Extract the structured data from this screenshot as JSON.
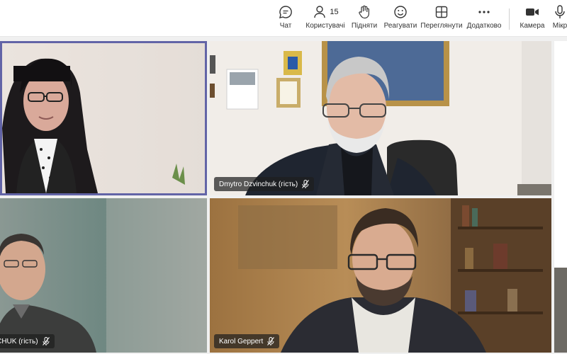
{
  "toolbar": {
    "chat": "Чат",
    "people": "Користувачі",
    "people_count": "15",
    "raise": "Підняти",
    "react": "Реагувати",
    "view": "Переглянути",
    "more": "Додатково",
    "camera": "Камера",
    "mic": "Мікр"
  },
  "participants": [
    {
      "name": ""
    },
    {
      "name": "Dmytro Dzvinchuk (гість)"
    },
    {
      "name": "TCHUK (гість)"
    },
    {
      "name": "Karol Geppert"
    }
  ],
  "colors": {
    "accent": "#6264a7",
    "tag_bg": "#1e1e1e"
  }
}
